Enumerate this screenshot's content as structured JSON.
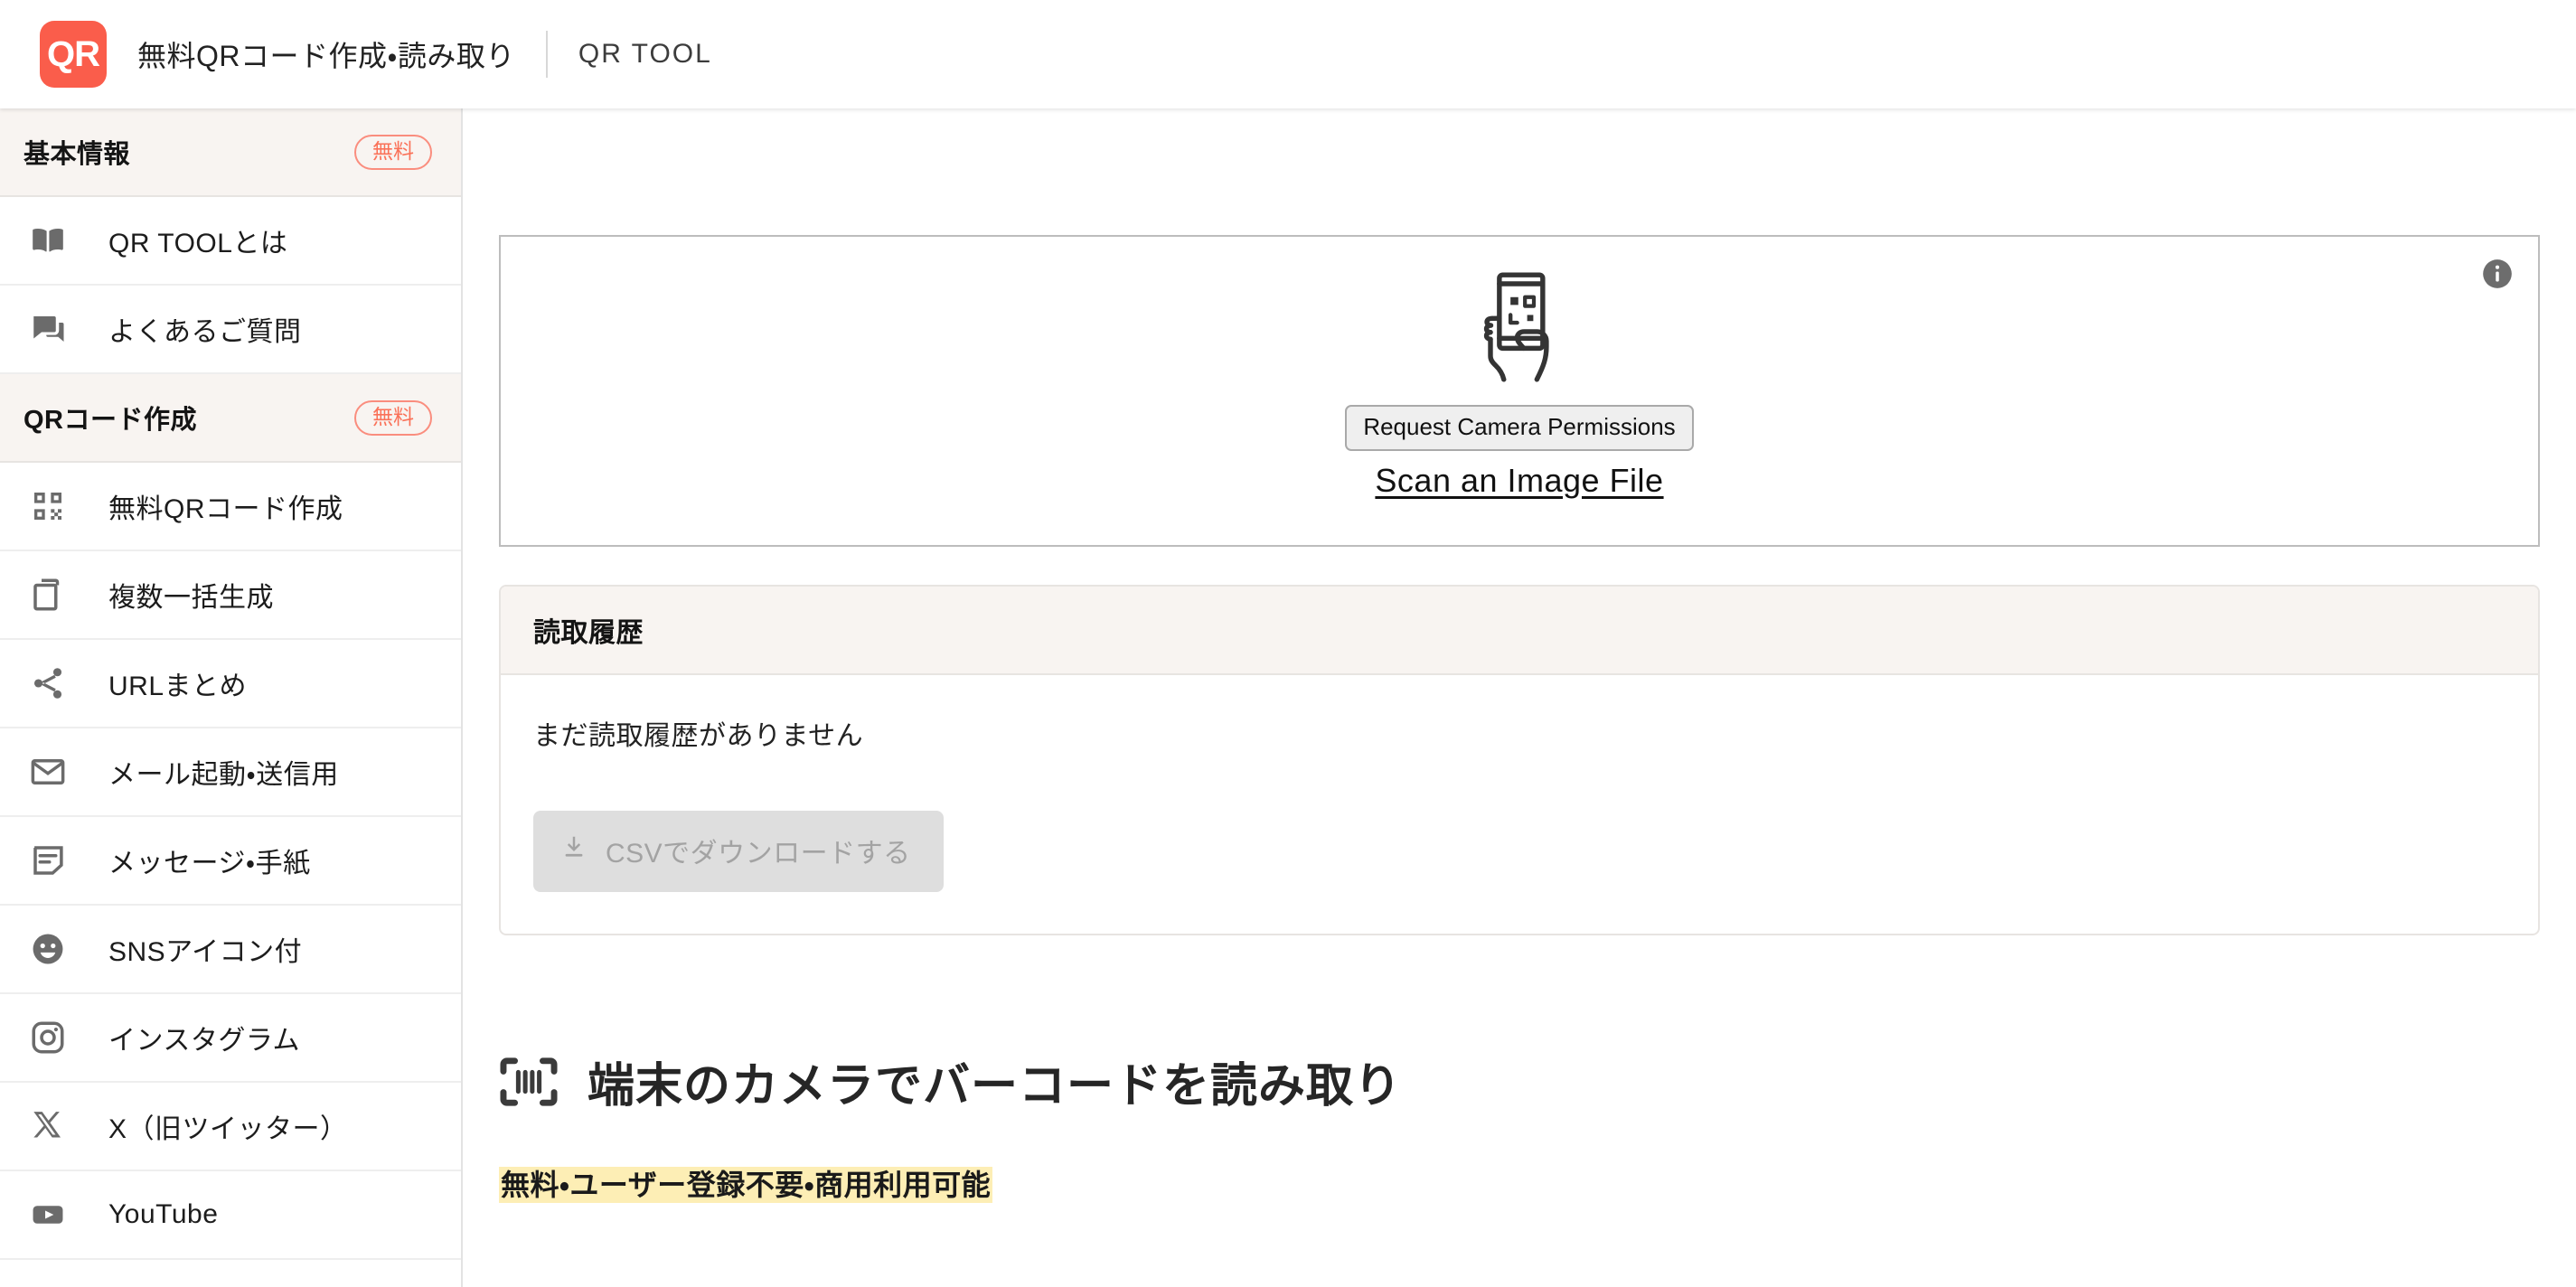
{
  "header": {
    "logo_text": "QR",
    "title": "無料QRコード作成・読み取り",
    "subtitle": "QR TOOL"
  },
  "sidebar": {
    "sections": [
      {
        "label": "基本情報",
        "badge": "無料",
        "items": [
          {
            "label": "QR TOOLとは",
            "icon": "book-icon"
          },
          {
            "label": "よくあるご質問",
            "icon": "chat-icon"
          }
        ]
      },
      {
        "label": "QRコード作成",
        "badge": "無料",
        "items": [
          {
            "label": "無料QRコード作成",
            "icon": "qr-code-icon"
          },
          {
            "label": "複数一括生成",
            "icon": "copy-icon"
          },
          {
            "label": "URLまとめ",
            "icon": "share-icon"
          },
          {
            "label": "メール起動・送信用",
            "icon": "mail-icon"
          },
          {
            "label": "メッセージ・手紙",
            "icon": "note-icon"
          },
          {
            "label": "SNSアイコン付",
            "icon": "smiley-icon"
          },
          {
            "label": "インスタグラム",
            "icon": "instagram-icon"
          },
          {
            "label": "X（旧ツイッター）",
            "icon": "x-twitter-icon"
          },
          {
            "label": "YouTube",
            "icon": "youtube-icon"
          }
        ]
      }
    ]
  },
  "scanner": {
    "info_icon": "info-icon",
    "illustration": "hand-holding-phone-qr-icon",
    "request_permission_label": "Request Camera Permissions",
    "scan_file_label": "Scan an Image File"
  },
  "history": {
    "title": "読取履歴",
    "empty_message": "まだ読取履歴がありません",
    "download_label": "CSVでダウンロードする",
    "download_icon": "download-icon"
  },
  "promo": {
    "heading_icon": "barcode-scan-icon",
    "heading": "端末のカメラでバーコードを読み取り",
    "highlight": "無料・ユーザー登録不要・商用利用可能"
  },
  "colors": {
    "brand": "#fa5d4b",
    "badge_text": "#fa7158",
    "section_bg": "#f8f4f1",
    "highlight": "#fdeeb5",
    "disabled_button": "#dedede"
  }
}
